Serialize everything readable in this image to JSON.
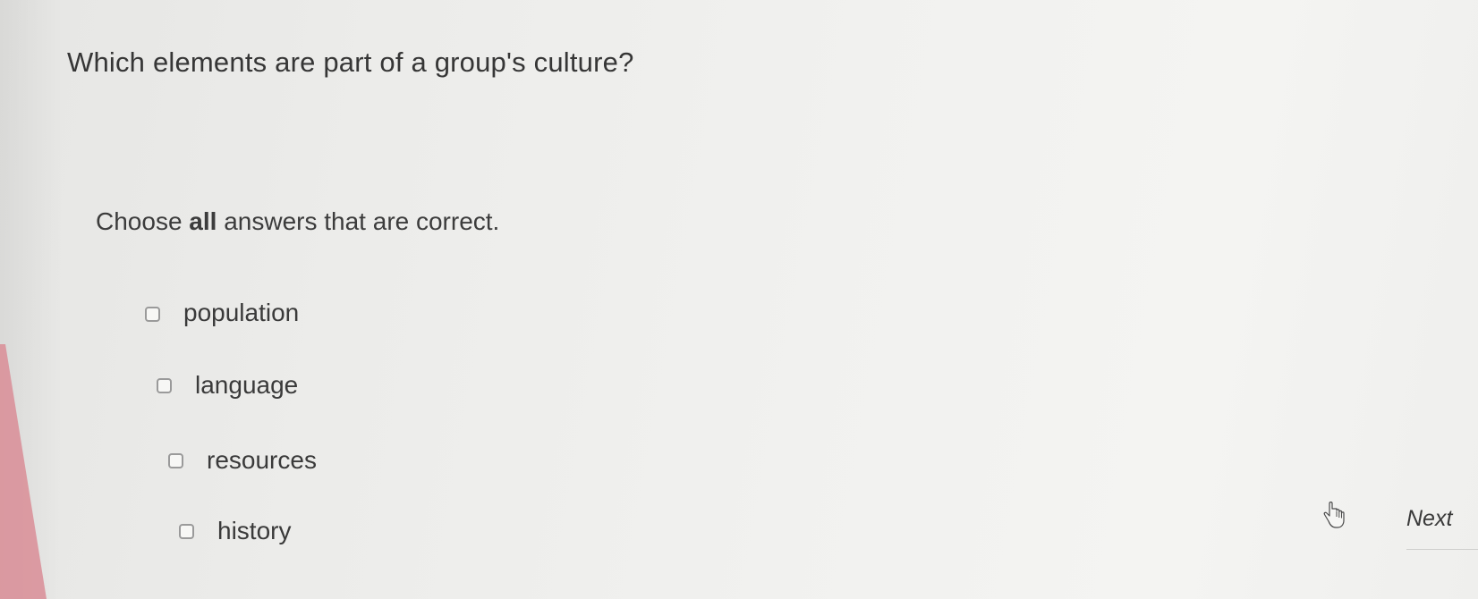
{
  "question": {
    "text": "Which elements are part of a group's culture?"
  },
  "instructions": {
    "prefix": "Choose ",
    "emphasis": "all",
    "suffix": " answers that are correct."
  },
  "options": [
    {
      "label": "population",
      "checked": false
    },
    {
      "label": "language",
      "checked": false
    },
    {
      "label": "resources",
      "checked": false
    },
    {
      "label": "history",
      "checked": false
    }
  ],
  "navigation": {
    "next_label": "Next",
    "cursor_icon": "hand-pointer-icon"
  },
  "colors": {
    "background": "#efefed",
    "text": "#3a3a3a",
    "checkbox_border": "#9a9a9a",
    "edge_accent": "#d98d96"
  }
}
